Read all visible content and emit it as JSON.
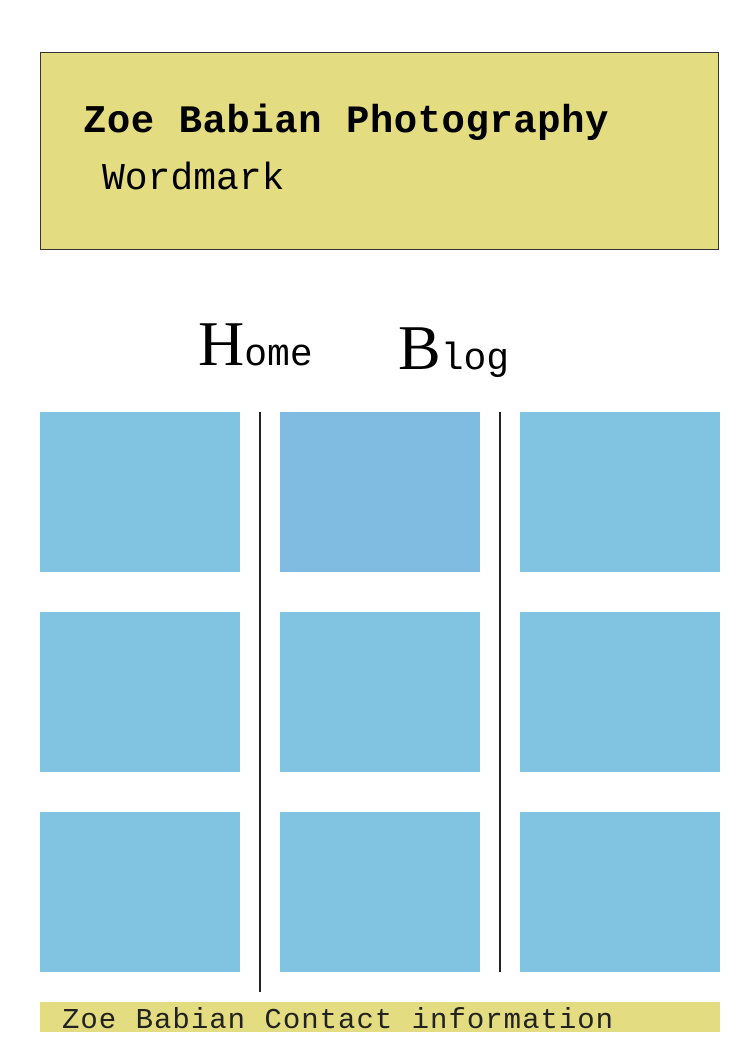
{
  "header": {
    "title": "Zoe Babian Photography",
    "wordmark": "Wordmark",
    "background_color": "#e3dc80"
  },
  "nav": {
    "items": [
      {
        "initial": "H",
        "rest": "ome",
        "label": "Home"
      },
      {
        "initial": "B",
        "rest": "log",
        "label": "Blog"
      }
    ]
  },
  "gallery": {
    "tile_color": "#80c4e2",
    "highlight_tile_color": "#80bbe2",
    "rows": 3,
    "columns": 3
  },
  "footer": {
    "text": "Zoe Babian Contact information",
    "background_color": "#e3dc80"
  }
}
